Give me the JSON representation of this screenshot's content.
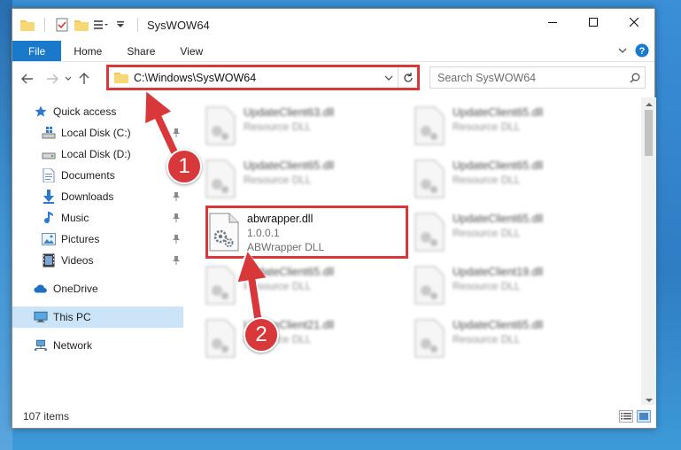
{
  "window": {
    "title": "SysWOW64"
  },
  "ribbon": {
    "tabs": [
      "File",
      "Home",
      "Share",
      "View"
    ]
  },
  "navigation": {
    "address": "C:\\Windows\\SysWOW64",
    "search_placeholder": "Search SysWOW64"
  },
  "sidebar": {
    "items": [
      {
        "label": "Quick access",
        "icon": "star-icon"
      },
      {
        "label": "Local Disk (C:)",
        "icon": "drive-icon"
      },
      {
        "label": "Local Disk (D:)",
        "icon": "drive-icon"
      },
      {
        "label": "Documents",
        "icon": "documents-icon"
      },
      {
        "label": "Downloads",
        "icon": "download-icon"
      },
      {
        "label": "Music",
        "icon": "music-icon"
      },
      {
        "label": "Pictures",
        "icon": "pictures-icon"
      },
      {
        "label": "Videos",
        "icon": "videos-icon"
      },
      {
        "label": "OneDrive",
        "icon": "cloud-icon"
      },
      {
        "label": "This PC",
        "icon": "computer-icon"
      },
      {
        "label": "Network",
        "icon": "network-icon"
      }
    ]
  },
  "files": {
    "highlighted": {
      "name": "abwrapper.dll",
      "version": "1.0.0.1",
      "description": "ABWrapper DLL"
    },
    "blurred": [
      {
        "name": "UpdateClient63.dll",
        "type": "Resource DLL"
      },
      {
        "name": "UpdateClient65.dll",
        "type": "Resource DLL"
      },
      {
        "name": "UpdateClient65.dll",
        "type": "Resource DLL"
      },
      {
        "name": "UpdateClient65.dll",
        "type": "Resource DLL"
      },
      {
        "name": "UpdateClient65.dll",
        "type": "Resource DLL"
      },
      {
        "name": "UpdateClient65.dll",
        "type": "Resource DLL"
      },
      {
        "name": "UpdateClient19.dll",
        "type": "Resource DLL"
      },
      {
        "name": "UpdateClient21.dll",
        "type": "Resource DLL"
      },
      {
        "name": "UpdateClient65.dll",
        "type": "Resource DLL"
      }
    ]
  },
  "status": {
    "item_count": "107 items"
  },
  "annotations": {
    "step1": "1",
    "step2": "2",
    "color": "#d9383a"
  }
}
